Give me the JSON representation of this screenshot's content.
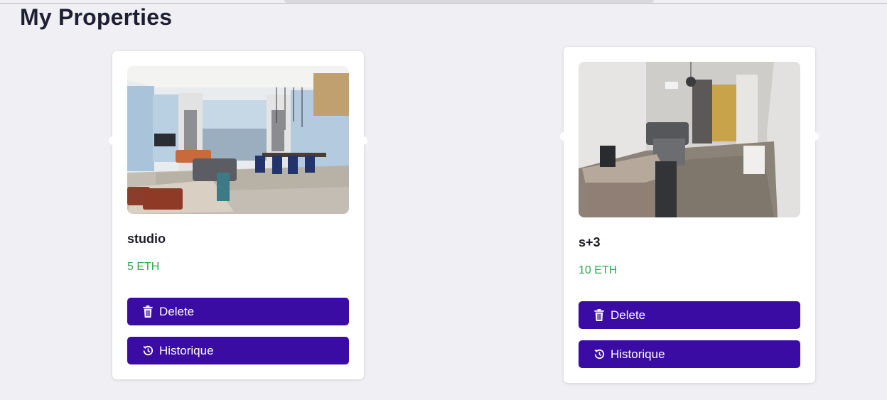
{
  "page": {
    "title": "My Properties"
  },
  "properties": [
    {
      "title": "studio",
      "price": "5 ETH",
      "photo_icon": "photo-modern-living-room",
      "delete_label": "Delete",
      "history_label": "Historique"
    },
    {
      "title": "s+3",
      "price": "10 ETH",
      "photo_icon": "photo-apartment-dining-room",
      "delete_label": "Delete",
      "history_label": "Historique"
    }
  ],
  "colors": {
    "background": "#efeff4",
    "button": "#3b0ca3",
    "price": "#2fa84f",
    "title": "#1f1f33"
  },
  "icons": {
    "delete": "trash-icon",
    "history": "history-icon"
  }
}
